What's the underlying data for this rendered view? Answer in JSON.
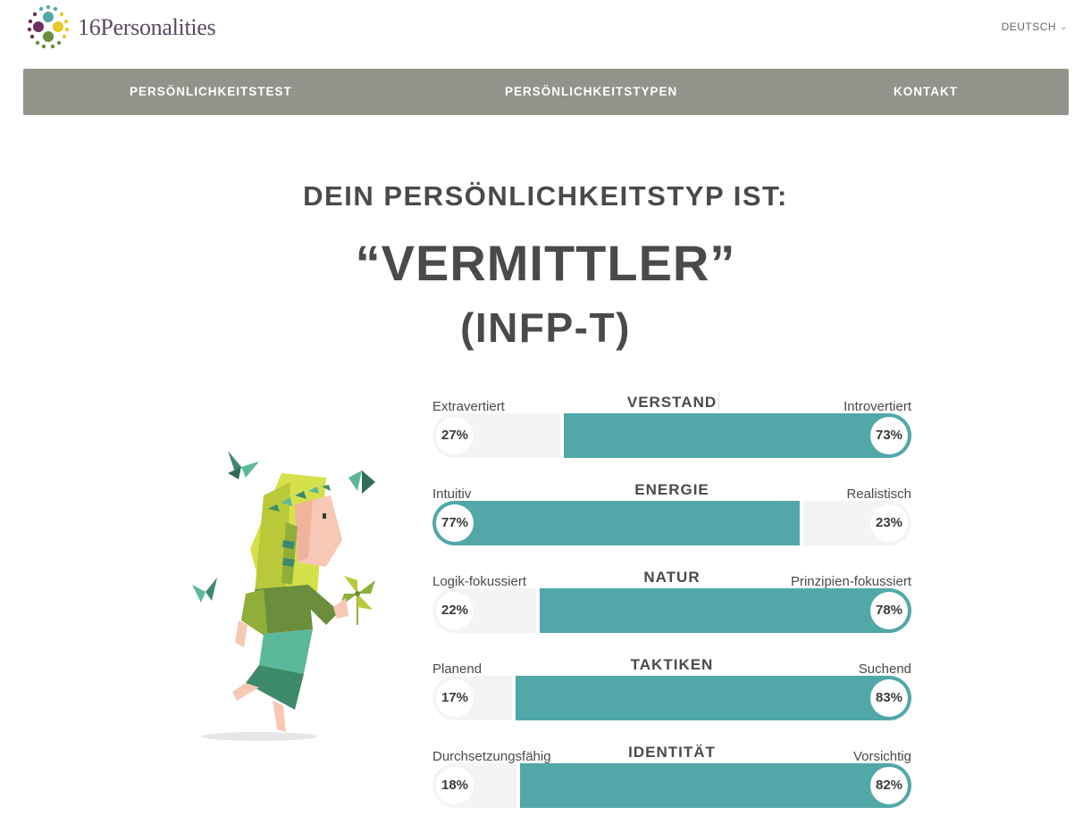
{
  "header": {
    "logo_text": "16Personalities",
    "language": "DEUTSCH"
  },
  "nav": {
    "items": [
      {
        "label": "PERSÖNLICHKEITSTEST"
      },
      {
        "label": "PERSÖNLICHKEITSTYPEN"
      },
      {
        "label": "KONTAKT"
      }
    ]
  },
  "result": {
    "intro": "DEIN PERSÖNLICHKEITSTYP IST:",
    "type_name": "“VERMITTLER”",
    "type_code": "(INFP-T)"
  },
  "traits": [
    {
      "title": "VERSTAND",
      "left_label": "Extravertiert",
      "right_label": "Introvertiert",
      "left_pct": 27,
      "right_pct": 73,
      "dominant": "right"
    },
    {
      "title": "ENERGIE",
      "left_label": "Intuitiv",
      "right_label": "Realistisch",
      "left_pct": 77,
      "right_pct": 23,
      "dominant": "left"
    },
    {
      "title": "NATUR",
      "left_label": "Logik-fokussiert",
      "right_label": "Prinzipien-fokussiert",
      "left_pct": 22,
      "right_pct": 78,
      "dominant": "right"
    },
    {
      "title": "TAKTIKEN",
      "left_label": "Planend",
      "right_label": "Suchend",
      "left_pct": 17,
      "right_pct": 83,
      "dominant": "right"
    },
    {
      "title": "IDENTITÄT",
      "left_label": "Durchsetzungsfähig",
      "right_label": "Vorsichtig",
      "left_pct": 18,
      "right_pct": 82,
      "dominant": "right"
    }
  ],
  "traits_text": {
    "t0": {
      "lp": "27%",
      "rp": "73%"
    },
    "t1": {
      "lp": "77%",
      "rp": "23%"
    },
    "t2": {
      "lp": "22%",
      "rp": "78%"
    },
    "t3": {
      "lp": "17%",
      "rp": "83%"
    },
    "t4": {
      "lp": "18%",
      "rp": "82%"
    }
  },
  "colors": {
    "accent": "#52a8a9",
    "nav_bg": "#93938b",
    "bar_bg": "#f4f4f4",
    "text": "#4a4a4a"
  },
  "icons": {
    "logo": "dotted-circle-logo-icon",
    "language_chevron": "chevron-down-icon",
    "character": "mediator-character-illustration"
  }
}
